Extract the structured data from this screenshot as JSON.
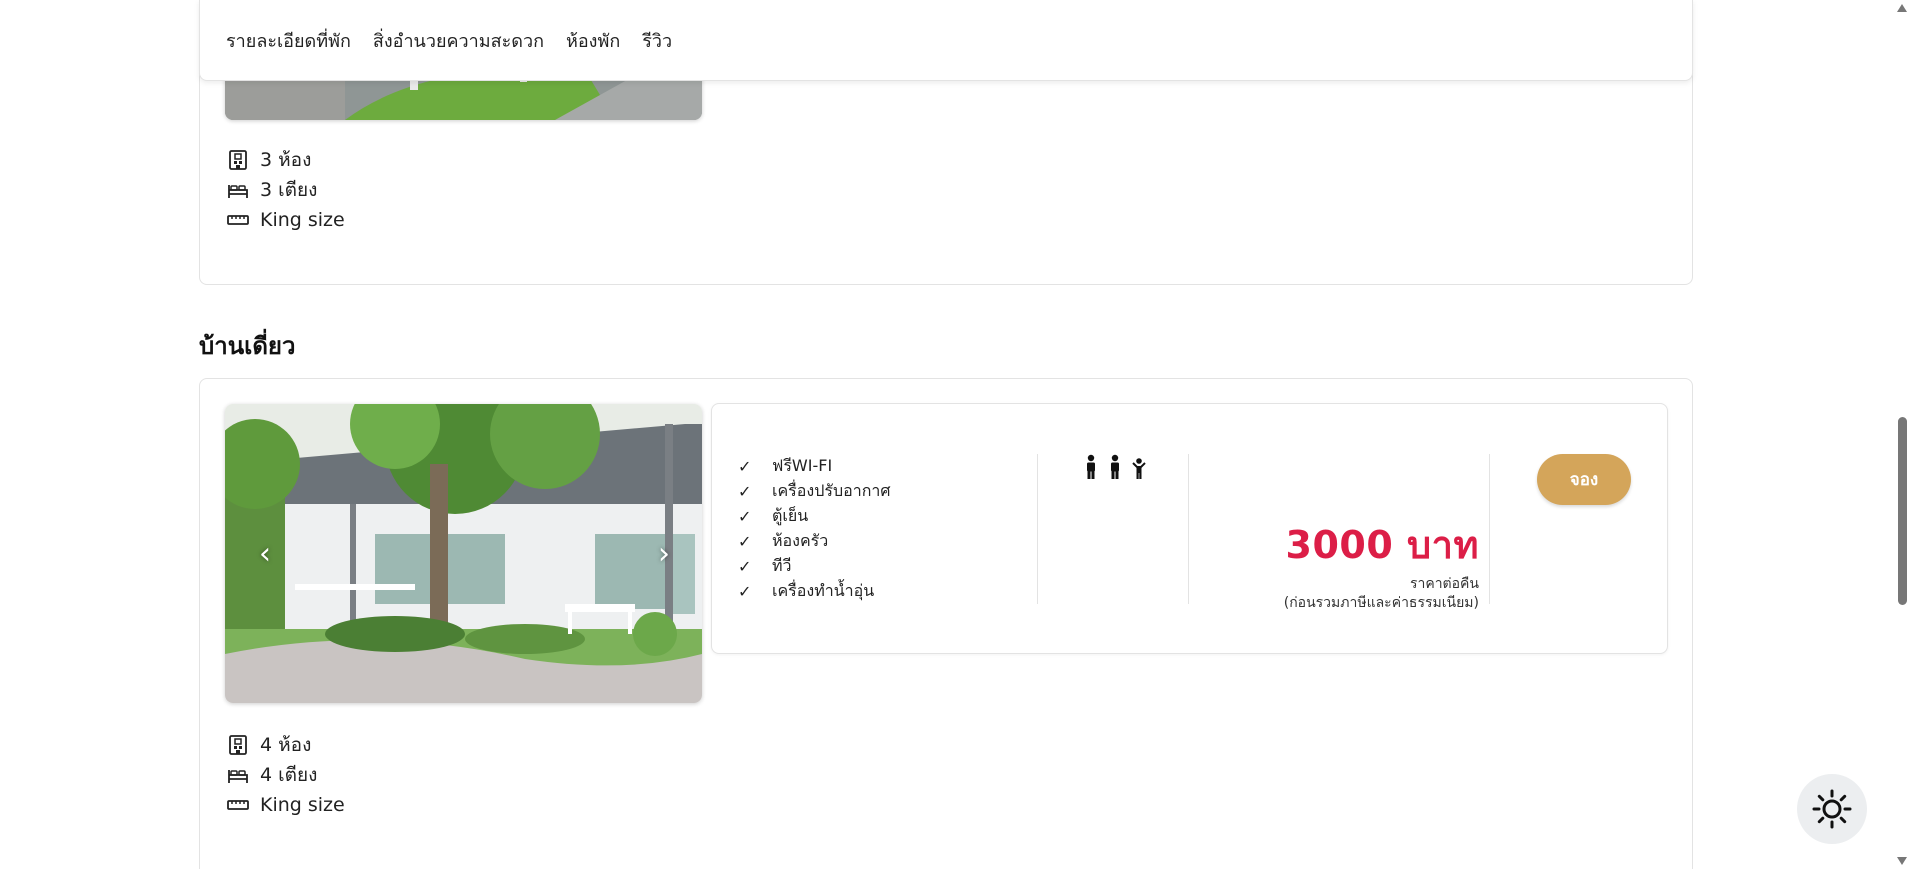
{
  "nav": {
    "items": [
      "รายละเอียดที่พัก",
      "สิ่งอำนวยความสะดวก",
      "ห้องพัก",
      "รีวิว"
    ]
  },
  "top_card": {
    "rooms": "3 ห้อง",
    "beds": "3 เตียง",
    "bed_size": "King size"
  },
  "section": {
    "title": "บ้านเดี่ยว"
  },
  "bottom_card": {
    "amenities": [
      "ฟรีWI-FI",
      "เครื่องปรับอากาศ",
      "ตู้เย็น",
      "ห้องครัว",
      "ทีวี",
      "เครื่องทำน้ำอุ่น"
    ],
    "check_mark": "✓",
    "price": "3000 บาท",
    "price_per_night": "ราคาต่อคืน",
    "price_note": "(ก่อนรวมภาษีและค่าธรรมเนียม)",
    "book_label": "จอง",
    "arrow_left": "‹",
    "arrow_right": "›",
    "rooms": "4 ห้อง",
    "beds": "4 เตียง",
    "bed_size": "King size"
  },
  "colors": {
    "price": "#dc1e47",
    "book_button": "#d4a55a"
  },
  "icons": {
    "rooms": "building-icon",
    "beds": "bed-icon",
    "size": "ruler-icon",
    "occupancy": "person-icon",
    "theme": "sun-icon"
  }
}
